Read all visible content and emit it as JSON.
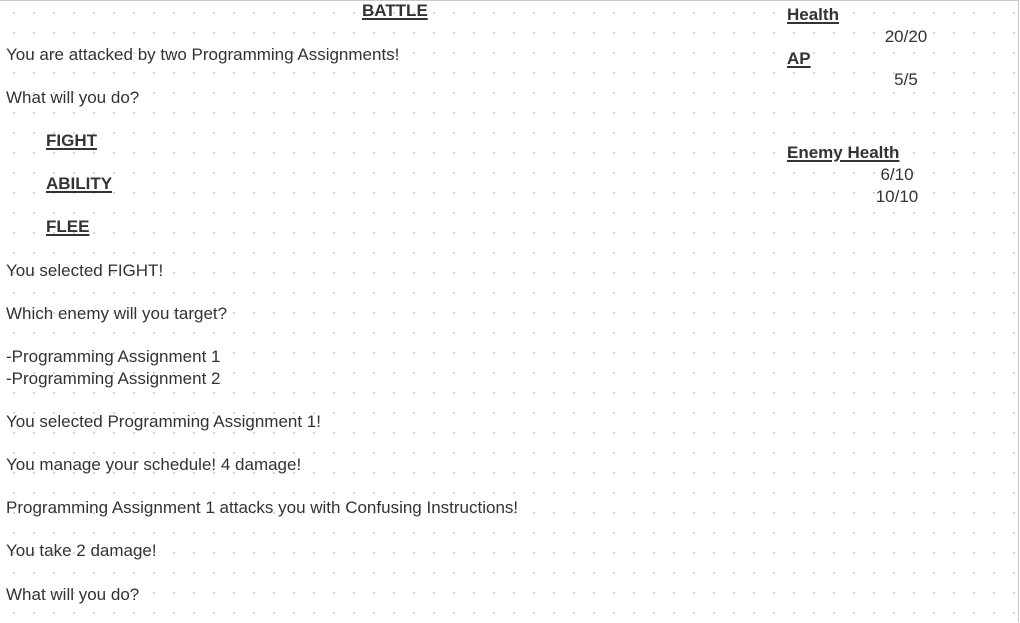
{
  "battle_title": "BATTLE",
  "log": [
    "You are attacked by two Programming Assignments!",
    "What will you do?",
    "You selected FIGHT!",
    "Which enemy will you target?",
    "-Programming Assignment 1",
    "-Programming Assignment 2",
    "You selected Programming Assignment 1!",
    "You manage your schedule! 4 damage!",
    "Programming Assignment 1 attacks you with Confusing Instructions!",
    "You take 2 damage!",
    "What will you do?"
  ],
  "menu": {
    "fight": "FIGHT",
    "ability": "ABILITY",
    "flee": "FLEE"
  },
  "stats": {
    "health_label": "Health",
    "health_value": "20/20",
    "ap_label": "AP",
    "ap_value": "5/5",
    "enemy_health_label": "Enemy Health",
    "enemy_health_values": [
      "6/10",
      "10/10"
    ]
  }
}
